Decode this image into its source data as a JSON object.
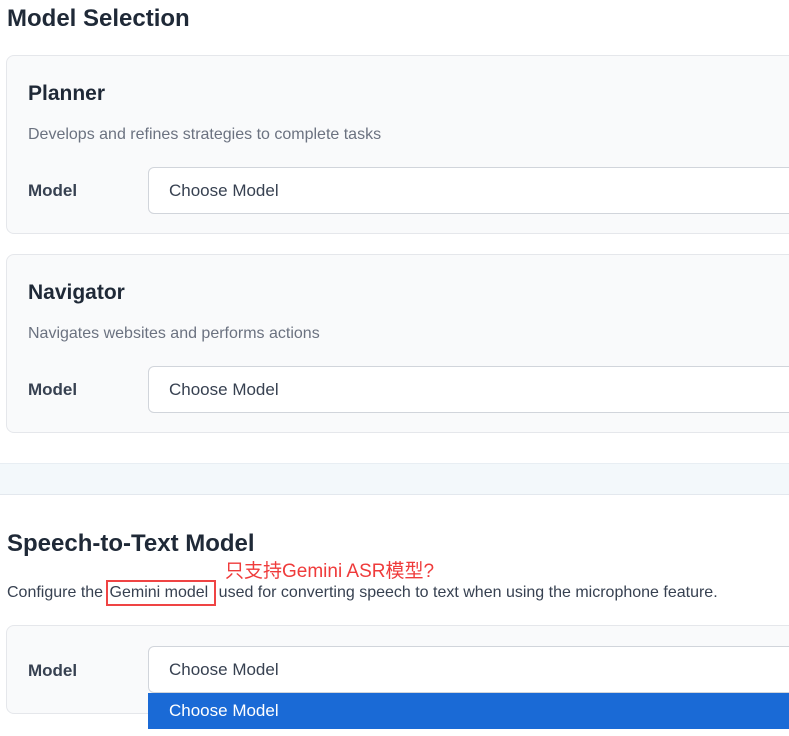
{
  "model_selection": {
    "title": "Model Selection",
    "planner": {
      "title": "Planner",
      "description": "Develops and refines strategies to complete tasks",
      "model_label": "Model",
      "model_value": "Choose Model"
    },
    "navigator": {
      "title": "Navigator",
      "description": "Navigates websites and performs actions",
      "model_label": "Model",
      "model_value": "Choose Model"
    }
  },
  "speech_to_text": {
    "title": "Speech-to-Text Model",
    "annotation": "只支持Gemini ASR模型?",
    "description_prefix": "Configure the ",
    "description_highlight": "Gemini model",
    "description_suffix": " used for converting speech to text when using the microphone feature.",
    "model_label": "Model",
    "model_value": "Choose Model",
    "dropdown_options": [
      "Choose Model"
    ]
  },
  "colors": {
    "annotation": "#ef3b3b",
    "highlight_border": "#ef4444",
    "selected_option_bg": "#1a6ad6"
  }
}
